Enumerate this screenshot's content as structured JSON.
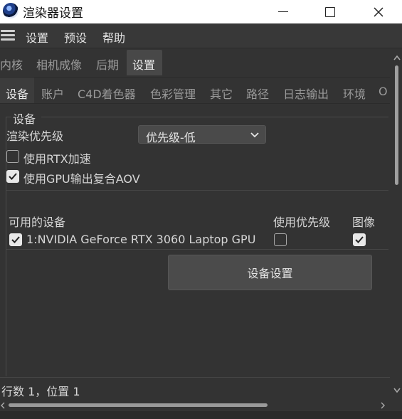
{
  "window": {
    "title": "渲染器设置",
    "buttons": [
      "minimize",
      "maximize",
      "close"
    ]
  },
  "menu": {
    "items": [
      "设置",
      "预设",
      "帮助"
    ]
  },
  "tabs_top": {
    "items": [
      "内核",
      "相机成像",
      "后期",
      "设置"
    ],
    "active": "设置"
  },
  "tabs_sub": {
    "items": [
      "设备",
      "账户",
      "C4D着色器",
      "色彩管理",
      "其它",
      "路径",
      "日志输出",
      "环境",
      "O"
    ],
    "active": "设备"
  },
  "device_group": {
    "title": "设备",
    "priority_label": "渲染优先级",
    "priority_value": "优先级-低",
    "rtx_label": "使用RTX加速",
    "rtx_checked": false,
    "aov_label": "使用GPU输出复合AOV",
    "aov_checked": true
  },
  "device_table": {
    "headers": [
      "可用的设备",
      "使用优先级",
      "图像"
    ],
    "rows": [
      {
        "enabled": true,
        "name": "1:NVIDIA GeForce RTX 3060 Laptop GPU",
        "use_priority": false,
        "image": true
      }
    ]
  },
  "device_settings_button": "设备设置",
  "status": {
    "text": "行数 1，位置 1"
  },
  "colors": {
    "background": "#333333",
    "titlebar": "#ffffff",
    "button": "#4b4b4b"
  }
}
